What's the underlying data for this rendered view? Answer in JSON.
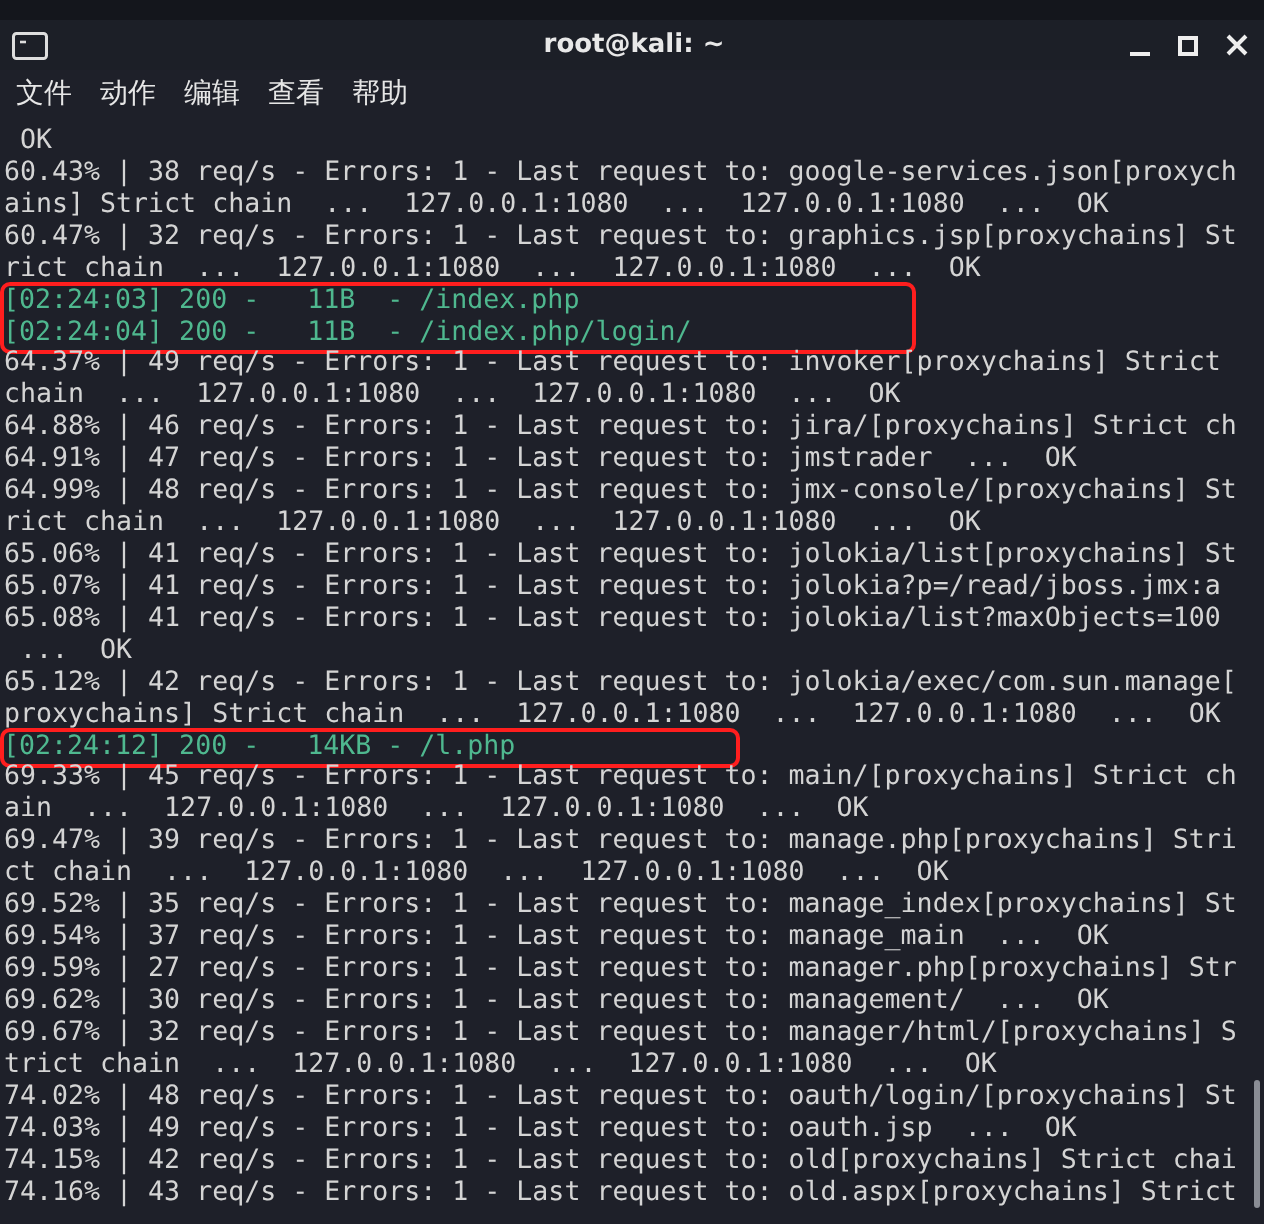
{
  "window": {
    "title": "root@kali: ~",
    "controls": [
      {
        "kind": "minimize"
      },
      {
        "kind": "maximize"
      },
      {
        "kind": "close"
      }
    ]
  },
  "menu": [
    "文件",
    "动作",
    "编辑",
    "查看",
    "帮助"
  ],
  "terminal": {
    "blocks": [
      {
        "highlighted": false,
        "lines": [
          {
            "kind": "log",
            "text": " OK"
          },
          {
            "kind": "log",
            "text": "60.43% | 38 req/s - Errors: 1 - Last request to: google-services.json[proxych"
          },
          {
            "kind": "log",
            "text": "ains] Strict chain  ...  127.0.0.1:1080  ...  127.0.0.1:1080  ...  OK"
          },
          {
            "kind": "log",
            "text": "60.47% | 32 req/s - Errors: 1 - Last request to: graphics.jsp[proxychains] St"
          },
          {
            "kind": "log",
            "text": "rict chain  ...  127.0.0.1:1080  ...  127.0.0.1:1080  ...  OK"
          }
        ]
      },
      {
        "highlighted": true,
        "lines": [
          {
            "kind": "hit",
            "text": "[02:24:03] 200 -   11B  - /index.php"
          },
          {
            "kind": "hit",
            "text": "[02:24:04] 200 -   11B  - /index.php/login/"
          }
        ]
      },
      {
        "highlighted": false,
        "lines": [
          {
            "kind": "log",
            "text": "64.37% | 49 req/s - Errors: 1 - Last request to: invoker[proxychains] Strict"
          },
          {
            "kind": "log",
            "text": "chain  ...  127.0.0.1:1080  ...  127.0.0.1:1080  ...  OK"
          },
          {
            "kind": "log",
            "text": "64.88% | 46 req/s - Errors: 1 - Last request to: jira/[proxychains] Strict ch"
          },
          {
            "kind": "log",
            "text": "64.91% | 47 req/s - Errors: 1 - Last request to: jmstrader  ...  OK"
          },
          {
            "kind": "log",
            "text": "64.99% | 48 req/s - Errors: 1 - Last request to: jmx-console/[proxychains] St"
          },
          {
            "kind": "log",
            "text": "rict chain  ...  127.0.0.1:1080  ...  127.0.0.1:1080  ...  OK"
          },
          {
            "kind": "log",
            "text": "65.06% | 41 req/s - Errors: 1 - Last request to: jolokia/list[proxychains] St"
          },
          {
            "kind": "log",
            "text": "65.07% | 41 req/s - Errors: 1 - Last request to: jolokia?p=/read/jboss.jmx:a"
          },
          {
            "kind": "log",
            "text": "65.08% | 41 req/s - Errors: 1 - Last request to: jolokia/list?maxObjects=100"
          },
          {
            "kind": "log",
            "text": " ...  OK"
          },
          {
            "kind": "log",
            "text": "65.12% | 42 req/s - Errors: 1 - Last request to: jolokia/exec/com.sun.manage["
          },
          {
            "kind": "log",
            "text": "proxychains] Strict chain  ...  127.0.0.1:1080  ...  127.0.0.1:1080  ...  OK"
          }
        ]
      },
      {
        "highlighted": true,
        "lines": [
          {
            "kind": "hit",
            "text": "[02:24:12] 200 -   14KB - /l.php"
          }
        ]
      },
      {
        "highlighted": false,
        "lines": [
          {
            "kind": "log",
            "text": "69.33% | 45 req/s - Errors: 1 - Last request to: main/[proxychains] Strict ch"
          },
          {
            "kind": "log",
            "text": "ain  ...  127.0.0.1:1080  ...  127.0.0.1:1080  ...  OK"
          },
          {
            "kind": "log",
            "text": "69.47% | 39 req/s - Errors: 1 - Last request to: manage.php[proxychains] Stri"
          },
          {
            "kind": "log",
            "text": "ct chain  ...  127.0.0.1:1080  ...  127.0.0.1:1080  ...  OK"
          },
          {
            "kind": "log",
            "text": "69.52% | 35 req/s - Errors: 1 - Last request to: manage_index[proxychains] St"
          },
          {
            "kind": "log",
            "text": "69.54% | 37 req/s - Errors: 1 - Last request to: manage_main  ...  OK"
          },
          {
            "kind": "log",
            "text": "69.59% | 27 req/s - Errors: 1 - Last request to: manager.php[proxychains] Str"
          },
          {
            "kind": "log",
            "text": "69.62% | 30 req/s - Errors: 1 - Last request to: management/  ...  OK"
          },
          {
            "kind": "log",
            "text": "69.67% | 32 req/s - Errors: 1 - Last request to: manager/html/[proxychains] S"
          },
          {
            "kind": "log",
            "text": "trict chain  ...  127.0.0.1:1080  ...  127.0.0.1:1080  ...  OK"
          },
          {
            "kind": "log",
            "text": "74.02% | 48 req/s - Errors: 1 - Last request to: oauth/login/[proxychains] St"
          },
          {
            "kind": "log",
            "text": "74.03% | 49 req/s - Errors: 1 - Last request to: oauth.jsp  ...  OK"
          },
          {
            "kind": "log",
            "text": "74.15% | 42 req/s - Errors: 1 - Last request to: old[proxychains] Strict chai"
          },
          {
            "kind": "log",
            "text": "74.16% | 43 req/s - Errors: 1 - Last request to: old.aspx[proxychains] Strict"
          }
        ]
      }
    ]
  }
}
